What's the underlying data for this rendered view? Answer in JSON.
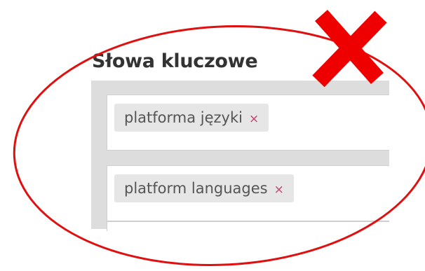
{
  "keywords_section": {
    "title": "Słowa kluczowe",
    "tags": [
      {
        "label": "platforma języki",
        "remove_symbol": "×"
      },
      {
        "label": "platform languages",
        "remove_symbol": "×"
      }
    ]
  },
  "annotation": {
    "circle_color": "#e01010",
    "cross_color": "#ee0000",
    "icon": "red-x-mark-icon"
  }
}
